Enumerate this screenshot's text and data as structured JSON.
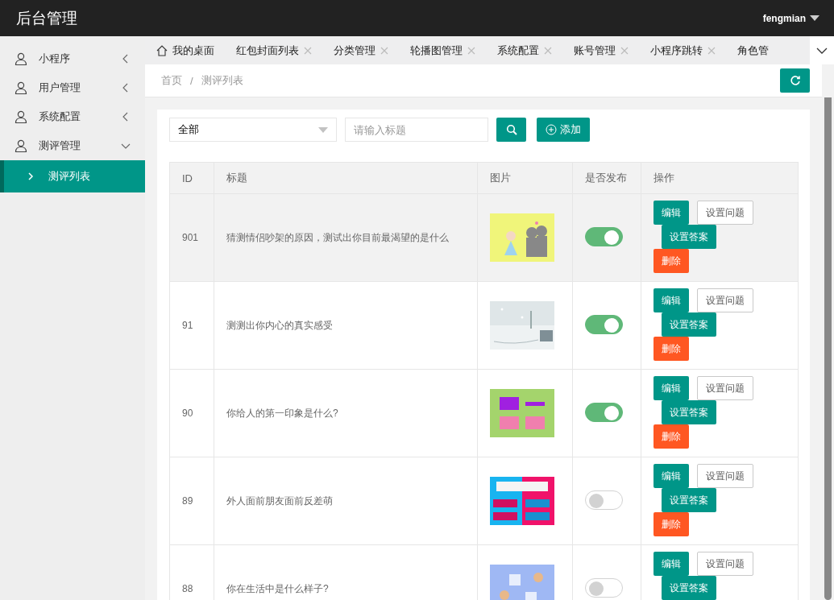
{
  "header": {
    "title": "后台管理",
    "user": "fengmian"
  },
  "sidebar": {
    "items": [
      {
        "label": "小程序",
        "expanded": false
      },
      {
        "label": "用户管理",
        "expanded": false
      },
      {
        "label": "系统配置",
        "expanded": false
      },
      {
        "label": "测评管理",
        "expanded": true,
        "children": [
          {
            "label": "测评列表",
            "selected": true
          }
        ]
      }
    ]
  },
  "tabs": [
    {
      "label": "我的桌面",
      "kind": "home"
    },
    {
      "label": "红包封面列表",
      "kind": "closable"
    },
    {
      "label": "分类管理",
      "kind": "closable"
    },
    {
      "label": "轮播图管理",
      "kind": "closable"
    },
    {
      "label": "系统配置",
      "kind": "closable"
    },
    {
      "label": "账号管理",
      "kind": "closable"
    },
    {
      "label": "小程序跳转",
      "kind": "closable"
    },
    {
      "label": "角色管",
      "kind": "cut"
    }
  ],
  "breadcrumb": [
    "首页",
    "测评列表"
  ],
  "breadcrumb_separator": "/",
  "filter": {
    "select_value": "全部",
    "search_placeholder": "请输入标题",
    "add_label": "添加"
  },
  "table": {
    "columns": [
      "ID",
      "标题",
      "图片",
      "是否发布",
      "操作"
    ],
    "rows": [
      {
        "id": "901",
        "title": "猜测情侣吵架的原因，测试出你目前最渴望的是什么",
        "highlighted": true,
        "published": true,
        "actions": [
          {
            "label": "编辑",
            "kind": "primary"
          },
          {
            "label": "设置问题",
            "kind": "plain"
          },
          {
            "label": "设置答案",
            "kind": "primary"
          },
          {
            "label": "删除",
            "kind": "danger"
          }
        ]
      },
      {
        "id": "91",
        "title": "测测出你内心的真实感受",
        "highlighted": false,
        "published": true,
        "actions": [
          {
            "label": "编辑",
            "kind": "primary"
          },
          {
            "label": "设置问题",
            "kind": "plain"
          },
          {
            "label": "设置答案",
            "kind": "primary"
          },
          {
            "label": "删除",
            "kind": "danger"
          }
        ]
      },
      {
        "id": "90",
        "title": "你给人的第一印象是什么?",
        "highlighted": false,
        "published": true,
        "actions": [
          {
            "label": "编辑",
            "kind": "primary"
          },
          {
            "label": "设置问题",
            "kind": "plain"
          },
          {
            "label": "设置答案",
            "kind": "primary"
          },
          {
            "label": "删除",
            "kind": "danger"
          }
        ]
      },
      {
        "id": "89",
        "title": "外人面前朋友面前反差萌",
        "highlighted": false,
        "published": false,
        "actions": [
          {
            "label": "编辑",
            "kind": "primary"
          },
          {
            "label": "设置问题",
            "kind": "plain"
          },
          {
            "label": "设置答案",
            "kind": "primary"
          },
          {
            "label": "删除",
            "kind": "danger"
          }
        ]
      },
      {
        "id": "88",
        "title": "你在生活中是什么样子?",
        "highlighted": false,
        "published": false,
        "actions": [
          {
            "label": "编辑",
            "kind": "primary"
          },
          {
            "label": "设置问题",
            "kind": "plain"
          },
          {
            "label": "设置答案",
            "kind": "primary"
          }
        ]
      }
    ]
  }
}
